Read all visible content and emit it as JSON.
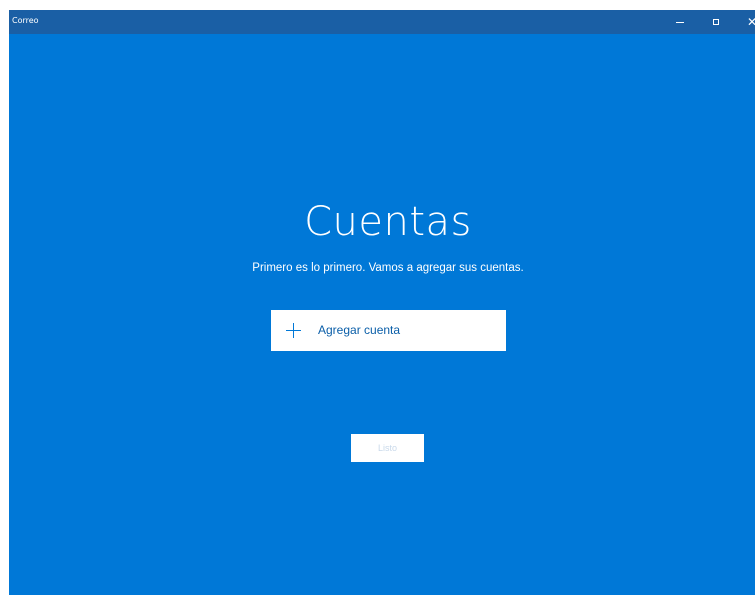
{
  "window": {
    "title": "Correo",
    "controls": {
      "minimize_icon": "minimize-icon",
      "maximize_icon": "maximize-icon",
      "close_icon": "close-icon",
      "close_glyph": "✕"
    }
  },
  "main": {
    "heading": "Cuentas",
    "subtitle": "Primero es lo primero. Vamos a agregar sus cuentas.",
    "add_account": {
      "icon": "plus-icon",
      "label": "Agregar cuenta"
    },
    "done_button": {
      "label": "Listo",
      "enabled": false
    }
  },
  "colors": {
    "background": "#0078d7",
    "titlebar": "#1a5fa5",
    "button_background": "#ffffff",
    "button_text": "#0a5ea8",
    "disabled_text": "#c9d9ea"
  }
}
